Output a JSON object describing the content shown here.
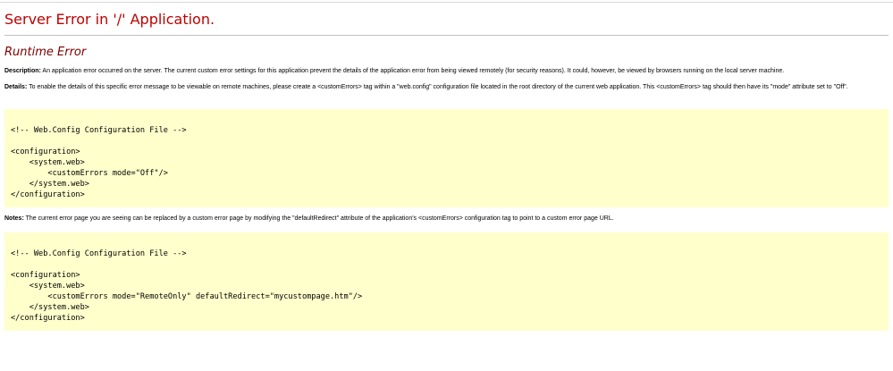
{
  "title": "Server Error in '/' Application.",
  "subtitle": "Runtime Error",
  "description": {
    "label": "Description:",
    "text": "An application error occurred on the server. The current custom error settings for this application prevent the details of the application error from being viewed remotely (for security reasons). It could, however, be viewed by browsers running on the local server machine."
  },
  "details": {
    "label": "Details:",
    "text": "To enable the details of this specific error message to be viewable on remote machines, please create a <customErrors> tag within a \"web.config\" configuration file located in the root directory of the current web application. This <customErrors> tag should then have its \"mode\" attribute set to \"Off\"."
  },
  "code1": "<!-- Web.Config Configuration File -->\n\n<configuration>\n    <system.web>\n        <customErrors mode=\"Off\"/>\n    </system.web>\n</configuration>",
  "notes": {
    "label": "Notes:",
    "text": "The current error page you are seeing can be replaced by a custom error page by modifying the \"defaultRedirect\" attribute of the application's <customErrors> configuration tag to point to a custom error page URL."
  },
  "code2": "<!-- Web.Config Configuration File -->\n\n<configuration>\n    <system.web>\n        <customErrors mode=\"RemoteOnly\" defaultRedirect=\"mycustompage.htm\"/>\n    </system.web>\n</configuration>"
}
